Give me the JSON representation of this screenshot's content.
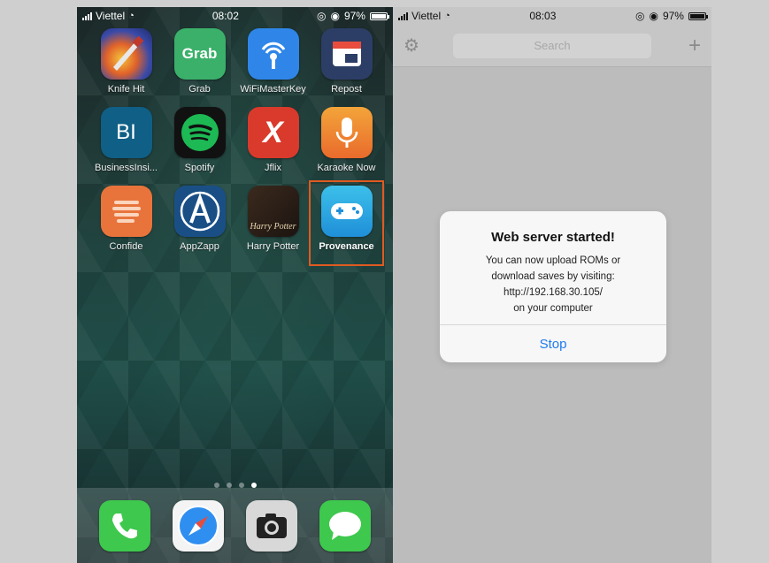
{
  "left_phone": {
    "status": {
      "carrier": "Viettel",
      "time": "08:02",
      "battery": "97%"
    },
    "apps": [
      {
        "label": "Knife Hit",
        "icon": "knife-hit-icon"
      },
      {
        "label": "Grab",
        "icon": "grab-icon",
        "icon_text": "Grab"
      },
      {
        "label": "WiFiMasterKey",
        "icon": "wifi-master-key-icon"
      },
      {
        "label": "Repost",
        "icon": "repost-icon"
      },
      {
        "label": "BusinessInsi...",
        "icon": "business-insider-icon",
        "icon_text": "BI"
      },
      {
        "label": "Spotify",
        "icon": "spotify-icon"
      },
      {
        "label": "Jflix",
        "icon": "jflix-icon",
        "icon_text": "X"
      },
      {
        "label": "Karaoke Now",
        "icon": "karaoke-now-icon"
      },
      {
        "label": "Confide",
        "icon": "confide-icon"
      },
      {
        "label": "AppZapp",
        "icon": "appzapp-icon"
      },
      {
        "label": "Harry Potter",
        "icon": "harry-potter-icon",
        "icon_text": "Harry Potter"
      },
      {
        "label": "Provenance",
        "icon": "provenance-icon",
        "highlighted": true
      }
    ],
    "page_dots": {
      "count": 4,
      "active_index": 3
    },
    "dock": [
      {
        "icon": "phone-icon"
      },
      {
        "icon": "safari-icon"
      },
      {
        "icon": "camera-icon"
      },
      {
        "icon": "messages-icon"
      }
    ]
  },
  "right_phone": {
    "status": {
      "carrier": "Viettel",
      "time": "08:03",
      "battery": "97%"
    },
    "navbar": {
      "search_placeholder": "Search"
    },
    "alert": {
      "title": "Web server started!",
      "lines": [
        "You can now upload ROMs or",
        "download saves by visiting:",
        "http://192.168.30.105/",
        "on your computer"
      ],
      "button": "Stop",
      "button_color": "#1f7af0"
    }
  },
  "colors": {
    "highlight_border": "#e05a20",
    "dim_overlay": "#cfcfcf"
  }
}
